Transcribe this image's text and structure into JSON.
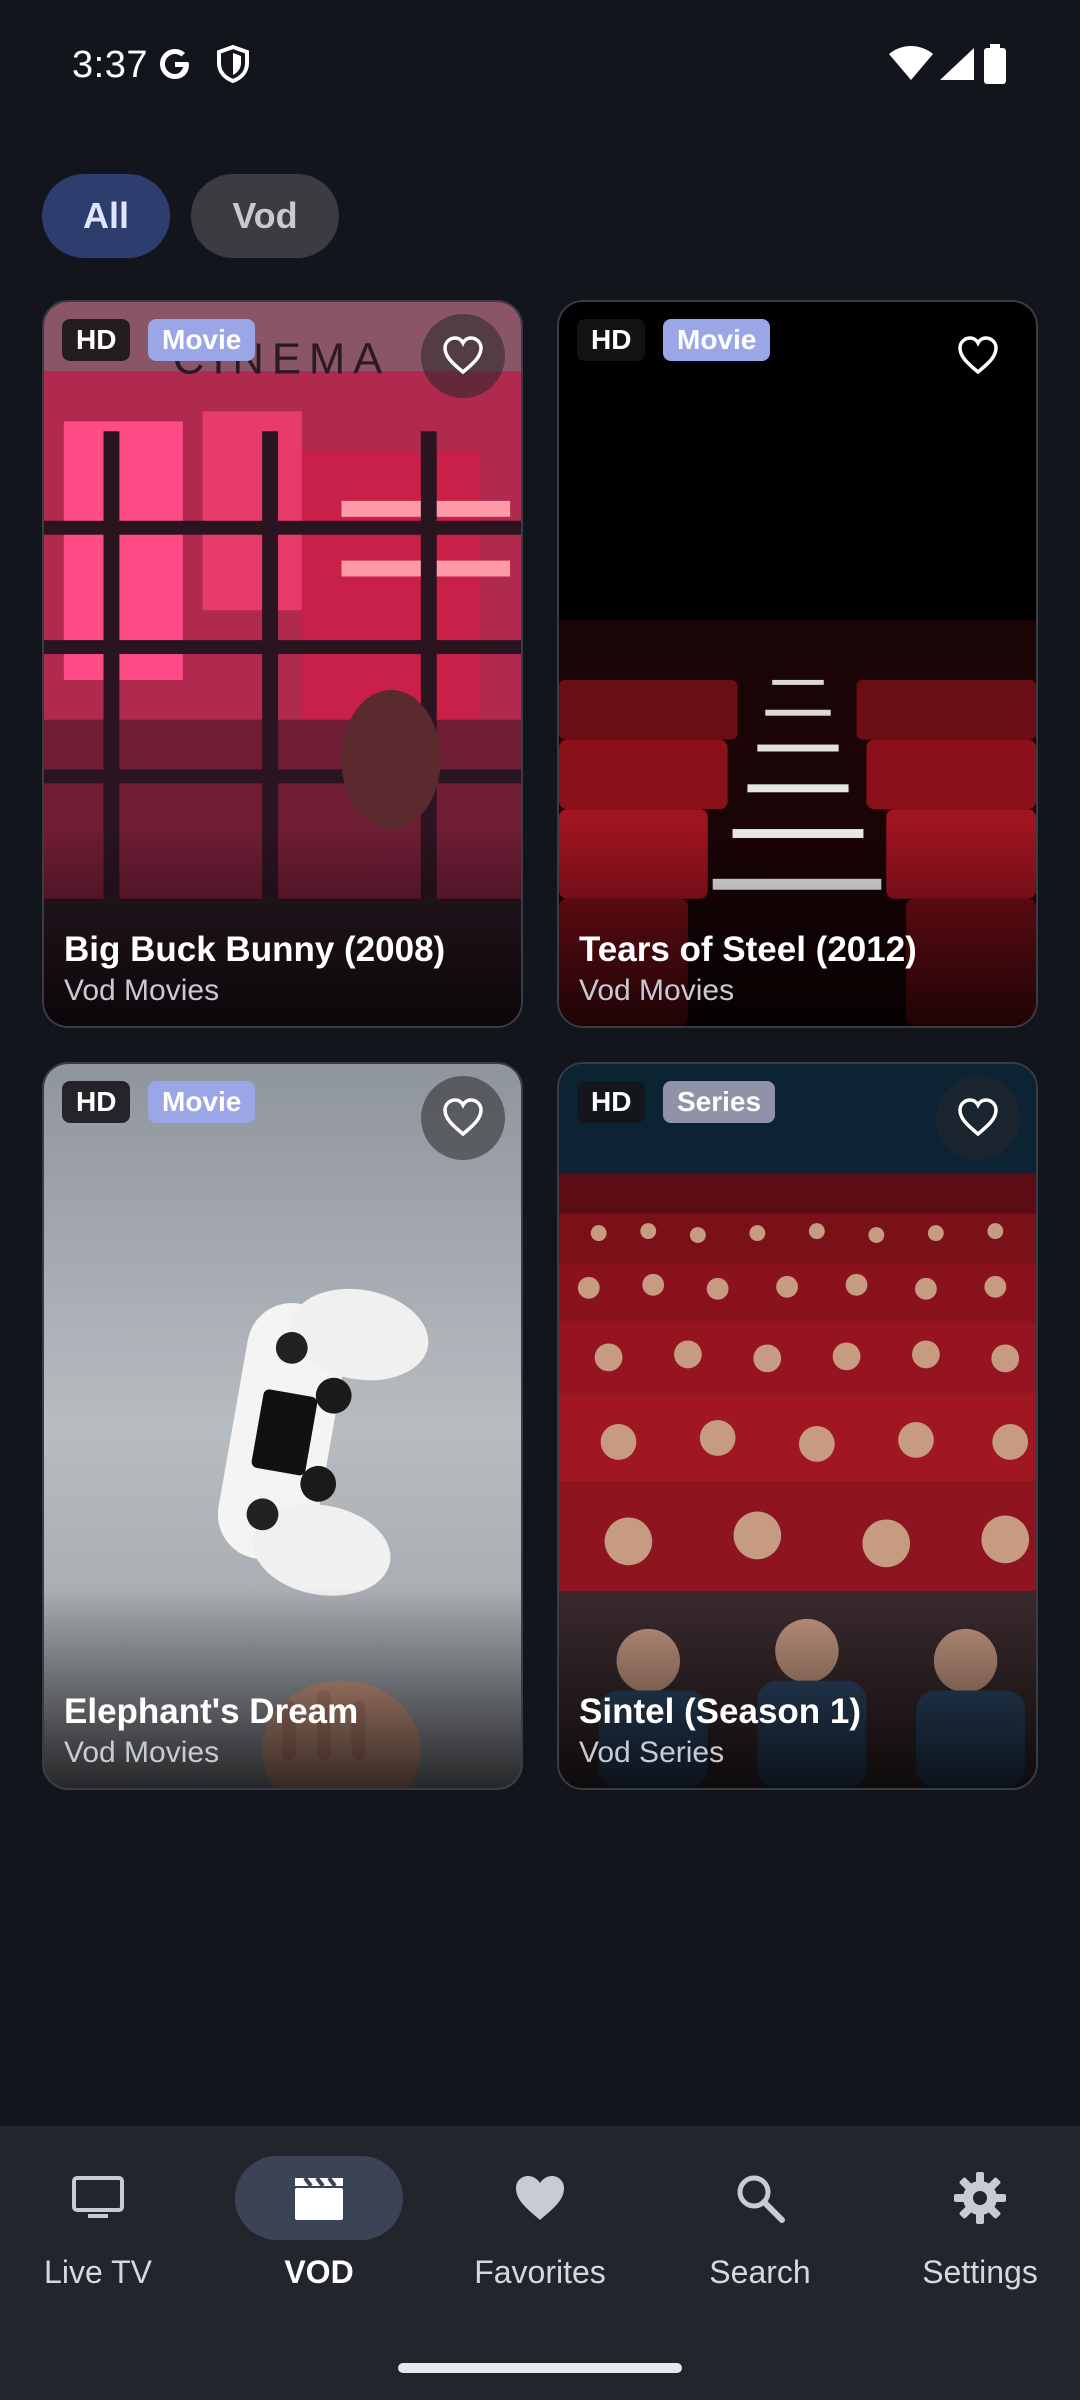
{
  "status_bar": {
    "time": "3:37",
    "icons": [
      "google-icon",
      "shield-icon",
      "wifi-icon",
      "signal-icon",
      "battery-icon"
    ]
  },
  "filters": {
    "chips": [
      {
        "label": "All",
        "selected": true
      },
      {
        "label": "Vod",
        "selected": false
      }
    ]
  },
  "cards": [
    {
      "title": "Big Buck Bunny (2008)",
      "subtitle": "Vod Movies",
      "quality": "HD",
      "type": "Movie",
      "image": "cinema-entrance-neon"
    },
    {
      "title": "Tears of Steel (2012)",
      "subtitle": "Vod Movies",
      "quality": "HD",
      "type": "Movie",
      "image": "red-theater-seats-stairs"
    },
    {
      "title": "Elephant's Dream",
      "subtitle": "Vod Movies",
      "quality": "HD",
      "type": "Movie",
      "image": "white-game-controller"
    },
    {
      "title": "Sintel (Season 1)",
      "subtitle": "Vod Series",
      "quality": "HD",
      "type": "Series",
      "image": "theater-audience"
    }
  ],
  "bottom_nav": {
    "items": [
      {
        "label": "Live TV",
        "icon": "tv-icon",
        "active": false
      },
      {
        "label": "VOD",
        "icon": "clapperboard-icon",
        "active": true
      },
      {
        "label": "Favorites",
        "icon": "heart-icon",
        "active": false
      },
      {
        "label": "Search",
        "icon": "search-icon",
        "active": false
      },
      {
        "label": "Settings",
        "icon": "gear-icon",
        "active": false
      }
    ]
  },
  "colors": {
    "background": "#13151c",
    "nav_background": "#23252c",
    "chip_selected": "#2d3d6d",
    "badge_movie": "#9aa6e6",
    "badge_series": "#8e93a8"
  }
}
